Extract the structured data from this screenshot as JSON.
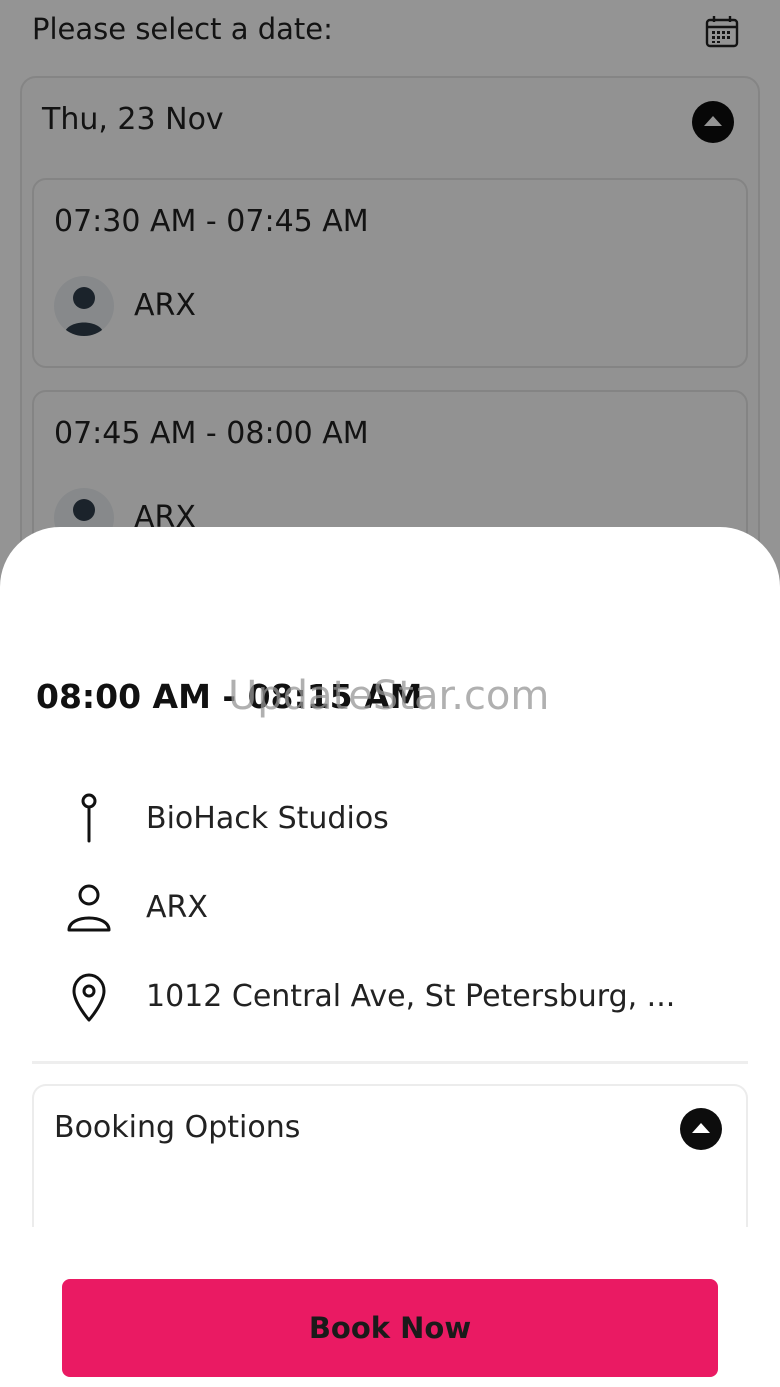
{
  "background_screen": {
    "title": "Please select a date:",
    "date": {
      "label": "Thu, 23 Nov",
      "slots": [
        {
          "time": "07:30 AM - 07:45 AM",
          "trainer": "ARX"
        },
        {
          "time": "07:45 AM - 08:00 AM",
          "trainer": "ARX"
        }
      ]
    }
  },
  "sheet": {
    "time": "08:00 AM - 08:15 AM",
    "watermark": "UpdateStar.com",
    "studio": "BioHack Studios",
    "trainer": "ARX",
    "address": "1012 Central Ave, St Petersburg, ...",
    "booking_options_title": "Booking Options",
    "book_button": "Book Now"
  },
  "colors": {
    "accent": "#ea1a63",
    "dark": "#0d0d0d"
  },
  "icons": {
    "calendar": "calendar-icon",
    "collapse": "chevron-up-icon",
    "studio": "pin-icon",
    "trainer": "person-icon",
    "address": "location-icon"
  }
}
